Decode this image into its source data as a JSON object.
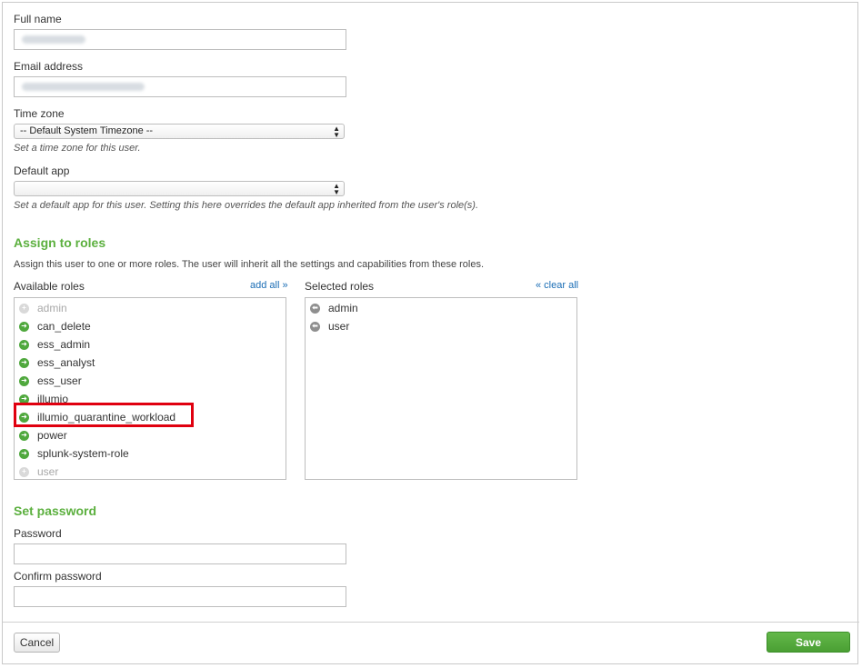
{
  "fields": {
    "full_name": {
      "label": "Full name",
      "value": ""
    },
    "email": {
      "label": "Email address",
      "value": ""
    },
    "time_zone": {
      "label": "Time zone",
      "selected": "-- Default System Timezone --",
      "help": "Set a time zone for this user."
    },
    "default_app": {
      "label": "Default app",
      "selected": "",
      "help": "Set a default app for this user. Setting this here overrides the default app inherited from the user's role(s)."
    }
  },
  "roles": {
    "title": "Assign to roles",
    "description": "Assign this user to one or more roles. The user will inherit all the settings and capabilities from these roles.",
    "available_label": "Available roles",
    "add_all": "add all »",
    "selected_label": "Selected roles",
    "clear_all": "« clear all",
    "available": [
      {
        "name": "admin",
        "disabled": true
      },
      {
        "name": "can_delete",
        "disabled": false
      },
      {
        "name": "ess_admin",
        "disabled": false
      },
      {
        "name": "ess_analyst",
        "disabled": false
      },
      {
        "name": "ess_user",
        "disabled": false
      },
      {
        "name": "illumio",
        "disabled": false
      },
      {
        "name": "illumio_quarantine_workload",
        "disabled": false,
        "highlighted": true
      },
      {
        "name": "power",
        "disabled": false
      },
      {
        "name": "splunk-system-role",
        "disabled": false
      },
      {
        "name": "user",
        "disabled": true
      }
    ],
    "selected": [
      {
        "name": "admin"
      },
      {
        "name": "user"
      }
    ],
    "highlight_color": "#e0000f"
  },
  "password": {
    "title": "Set password",
    "password_label": "Password",
    "confirm_label": "Confirm password"
  },
  "footer": {
    "cancel_label": "Cancel",
    "save_label": "Save"
  },
  "colors": {
    "accent_green": "#5cb03f",
    "link_blue": "#1a6db5",
    "save_green": "#4a9f33"
  }
}
